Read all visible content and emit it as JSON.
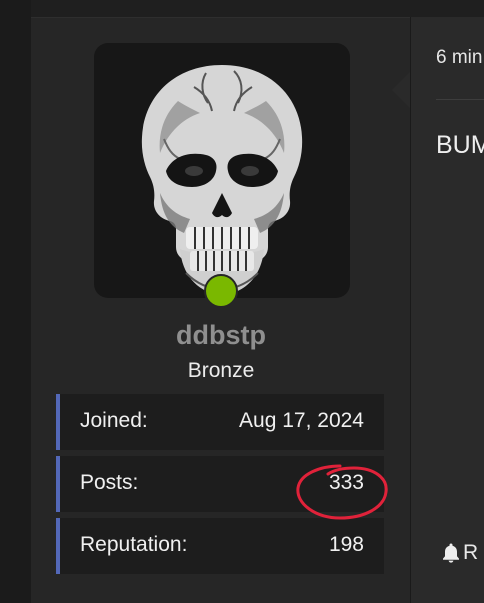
{
  "post": {
    "time_text": "6 min",
    "body_text": "BUM",
    "reaction_label": "R"
  },
  "profile": {
    "username": "ddbstp",
    "rank": "Bronze",
    "online": true,
    "stats": [
      {
        "label": "Joined:",
        "value": "Aug 17, 2024"
      },
      {
        "label": "Posts:",
        "value": "333"
      },
      {
        "label": "Reputation:",
        "value": "198"
      }
    ]
  },
  "icons": {
    "avatar": "skull-avatar",
    "status": "online-dot",
    "reaction": "bell-icon"
  },
  "colors": {
    "accent_border": "#5368b8",
    "online": "#7ab800",
    "annotation": "#e0223a"
  }
}
